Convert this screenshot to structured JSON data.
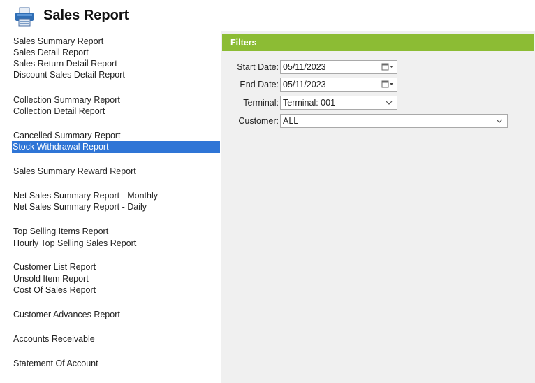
{
  "header": {
    "title": "Sales Report",
    "icon": "printer-icon"
  },
  "sidebar": {
    "items": [
      {
        "label": "Sales Summary Report"
      },
      {
        "label": "Sales Detail Report"
      },
      {
        "label": "Sales Return Detail Report"
      },
      {
        "label": "Discount Sales Detail Report"
      },
      {
        "label": "Collection Summary Report"
      },
      {
        "label": "Collection Detail Report"
      },
      {
        "label": "Cancelled Summary Report"
      },
      {
        "label": "Stock Withdrawal Report",
        "selected": true
      },
      {
        "label": "Sales Summary Reward Report"
      },
      {
        "label": "Net Sales Summary Report - Monthly"
      },
      {
        "label": "Net Sales Summary Report - Daily"
      },
      {
        "label": "Top Selling Items Report"
      },
      {
        "label": "Hourly Top Selling Sales Report"
      },
      {
        "label": "Customer List Report"
      },
      {
        "label": "Unsold Item Report"
      },
      {
        "label": "Cost Of Sales Report"
      },
      {
        "label": "Customer Advances Report"
      },
      {
        "label": "Accounts Receivable"
      },
      {
        "label": "Statement Of Account"
      }
    ]
  },
  "filters": {
    "title": "Filters",
    "start_date": {
      "label": "Start Date:",
      "value": "05/11/2023"
    },
    "end_date": {
      "label": "End Date:",
      "value": "05/11/2023"
    },
    "terminal": {
      "label": "Terminal:",
      "value": "Terminal: 001"
    },
    "customer": {
      "label": "Customer:",
      "value": "ALL"
    }
  },
  "colors": {
    "accent_green": "#8cbc34",
    "selection_blue": "#2f75d6",
    "panel_gray": "#f0f0f0"
  }
}
